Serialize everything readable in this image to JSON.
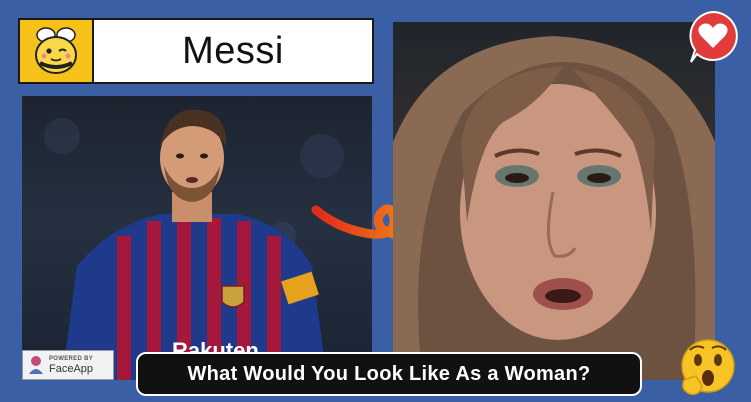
{
  "header": {
    "name": "Messi",
    "logo_icon": "bee-icon"
  },
  "badge": {
    "powered_by": "POWERED BY",
    "app_name": "FaceApp"
  },
  "caption": {
    "text": "What Would You Look Like As a Woman?"
  },
  "icons": {
    "like": "heart-icon",
    "reaction": "surprised-emoji-icon",
    "transition": "curved-arrow-icon"
  },
  "colors": {
    "background": "#3a5fa5",
    "logo_bg": "#f6c21a",
    "caption_bg": "#111111",
    "heart_bubble": "#e23b3b",
    "arrow": "#f25a1f"
  }
}
